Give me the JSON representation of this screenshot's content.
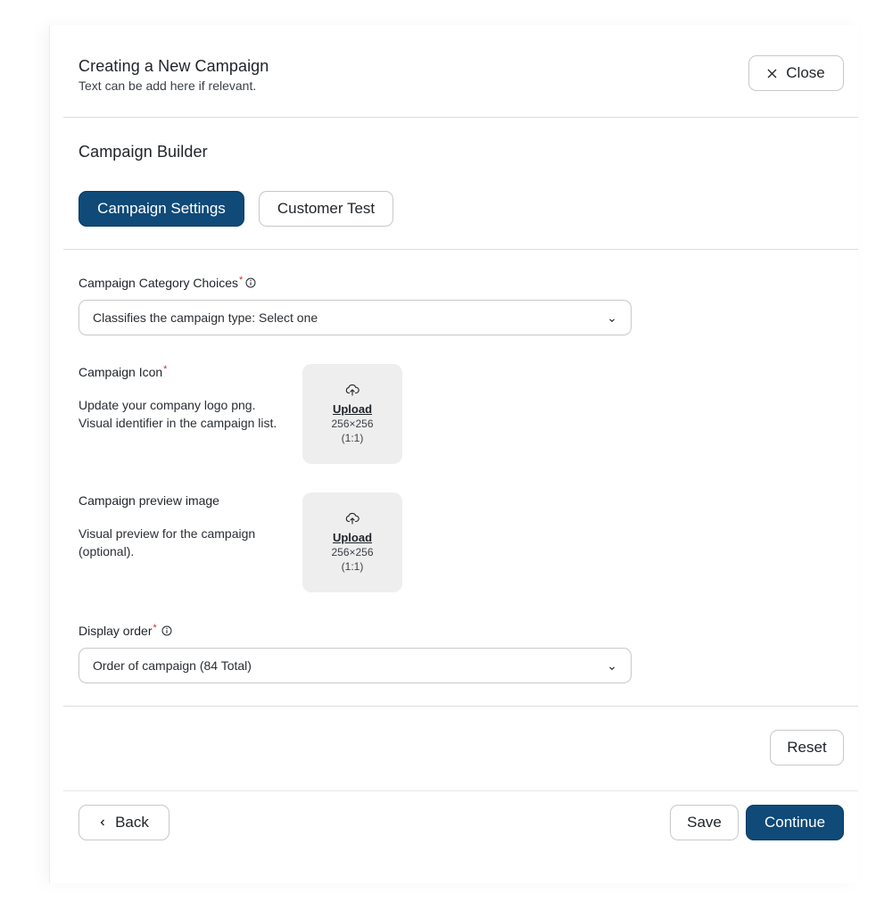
{
  "header": {
    "title": "Creating a New Campaign",
    "subtitle": "Text can be add here if relevant.",
    "close_label": "Close"
  },
  "builder": {
    "heading": "Campaign Builder",
    "tabs": [
      {
        "label": "Campaign Settings",
        "active": true
      },
      {
        "label": "Customer Test",
        "active": false
      }
    ]
  },
  "form": {
    "category": {
      "label": "Campaign Category Choices",
      "required_mark": "*",
      "value": "Classifies the campaign type: Select one"
    },
    "icon": {
      "label": "Campaign Icon",
      "required_mark": "*",
      "description_line1": "Update your company logo png.",
      "description_line2": "Visual identifier in the campaign list.",
      "upload_label": "Upload",
      "size": "256×256",
      "ratio": "(1:1)"
    },
    "preview": {
      "label": "Campaign preview image",
      "description_line1": "Visual preview for the campaign",
      "description_line2": "(optional).",
      "upload_label": "Upload",
      "size": "256×256",
      "ratio": "(1:1)"
    },
    "display_order": {
      "label": "Display order",
      "required_mark": "*",
      "value": "Order of campaign (84 Total)"
    }
  },
  "actions": {
    "reset_label": "Reset",
    "back_label": "Back",
    "save_label": "Save",
    "continue_label": "Continue"
  },
  "colors": {
    "primary": "#0f4a78",
    "required": "#d93025",
    "upload_bg": "#eeeeee"
  },
  "icons": [
    "close-icon",
    "info-icon",
    "chevron-down-icon",
    "upload-cloud-icon",
    "chevron-left-icon"
  ]
}
